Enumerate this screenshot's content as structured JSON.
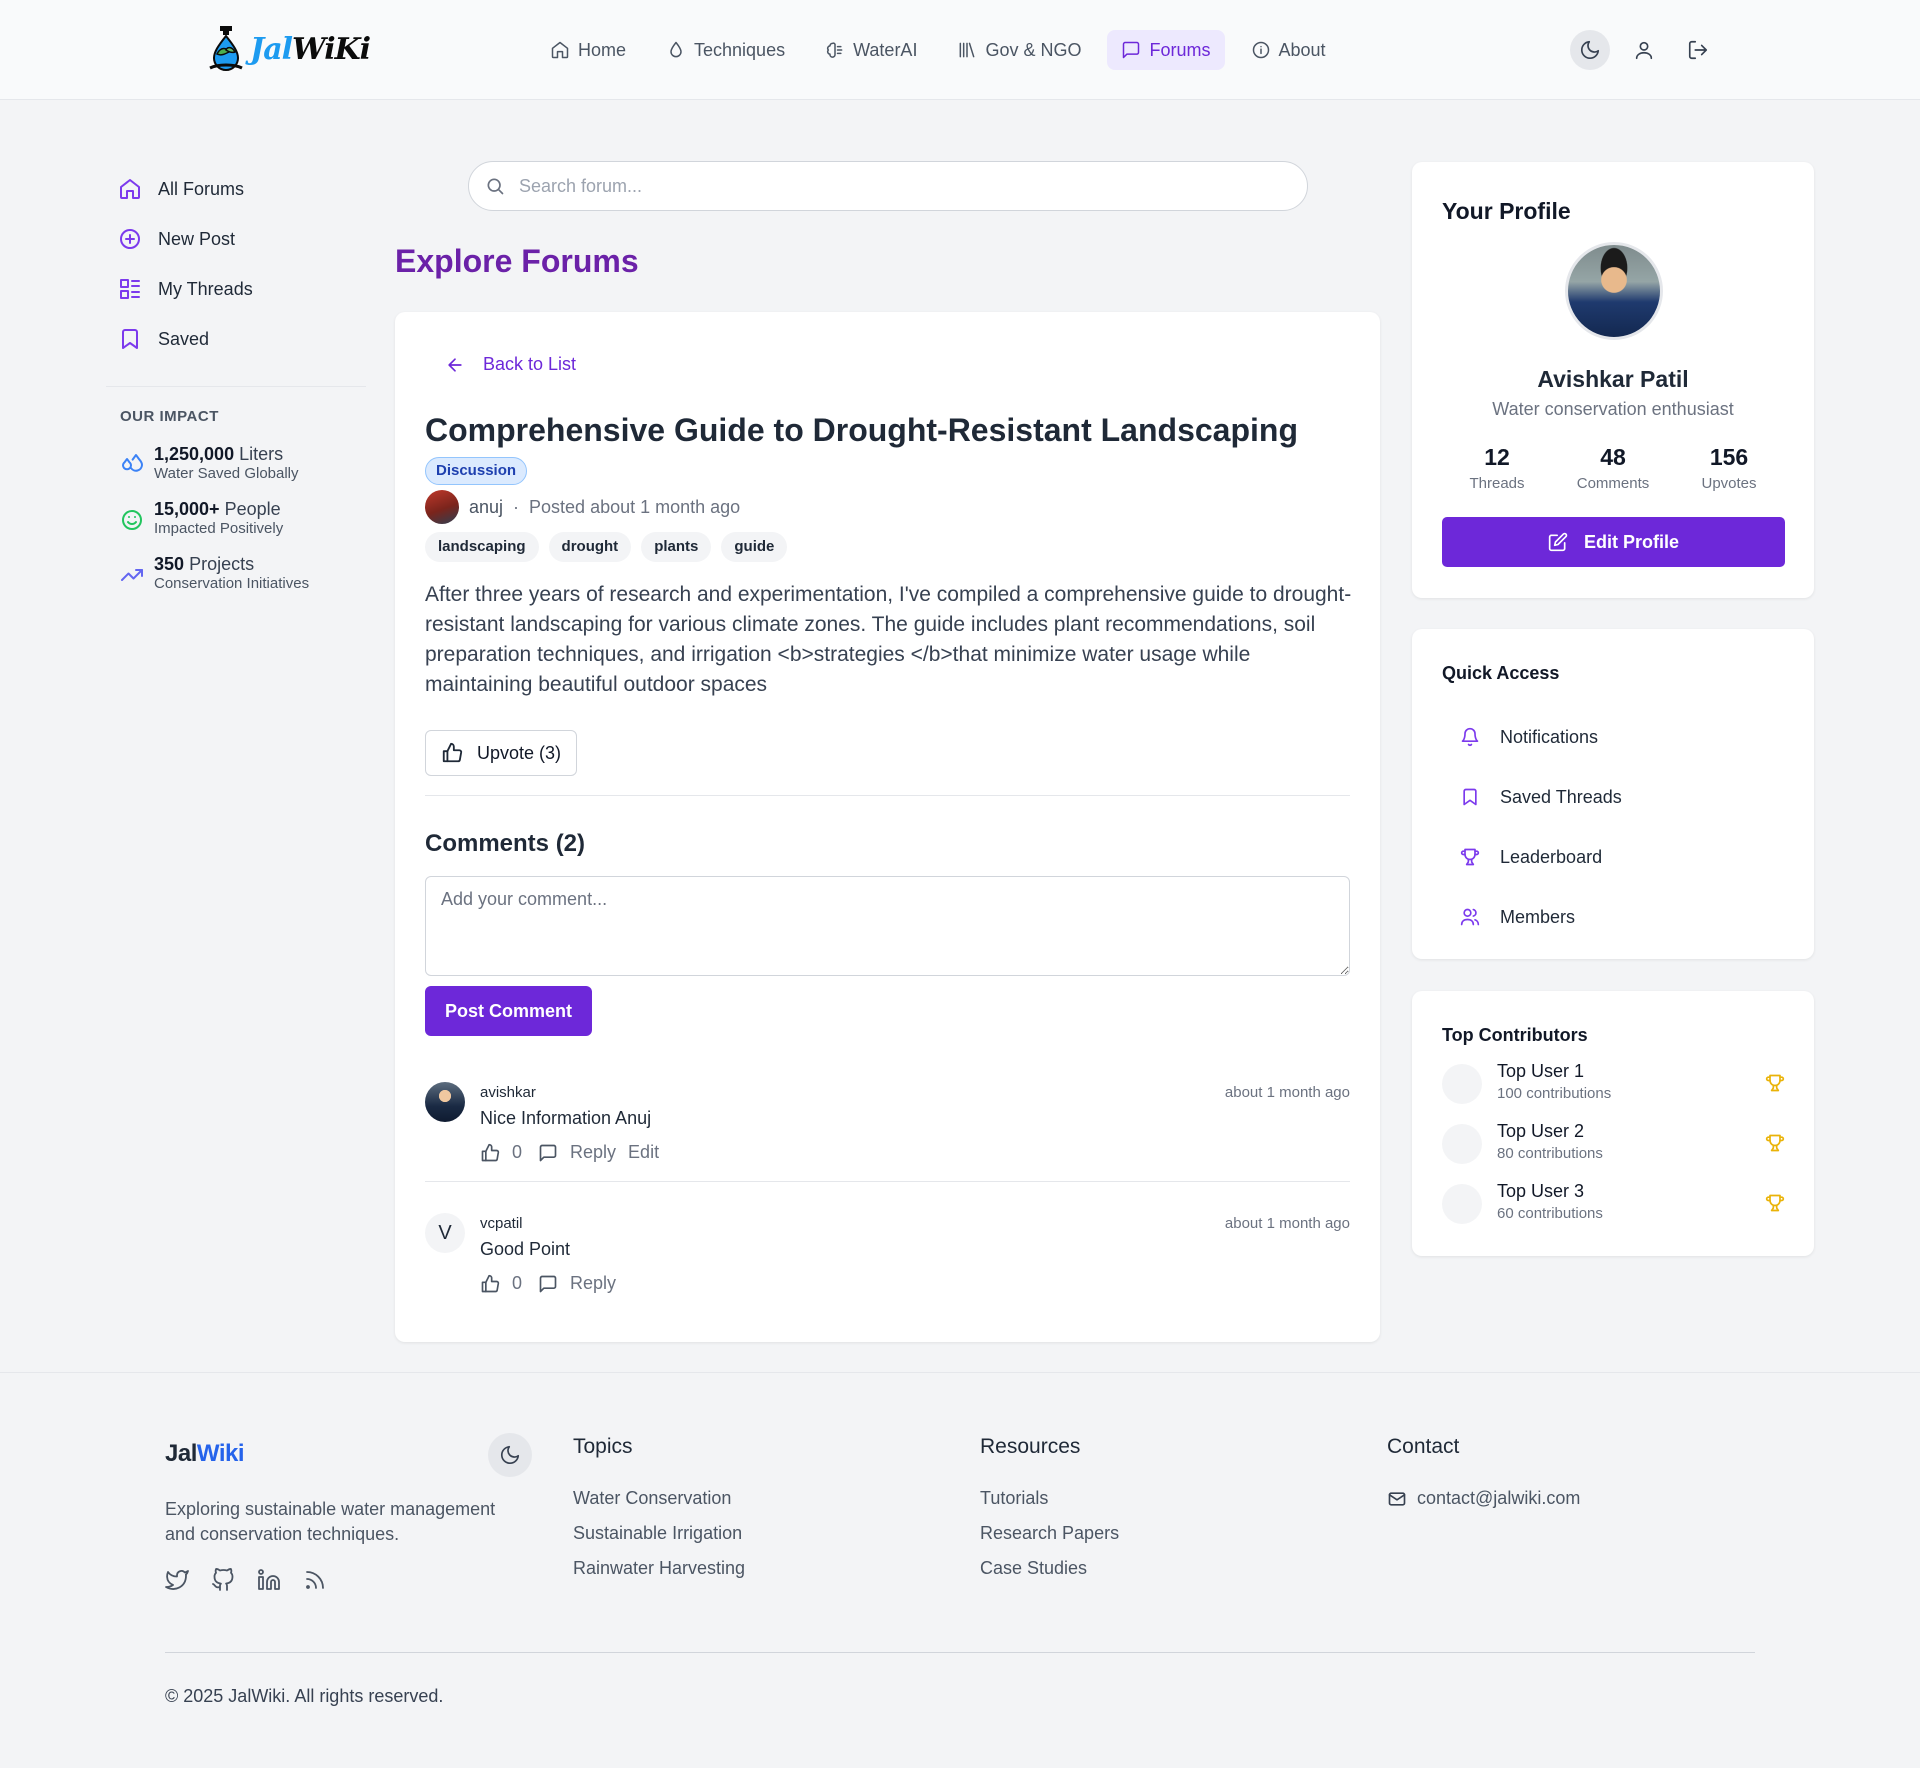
{
  "brand": {
    "logo_jal": "Jal",
    "logo_wiki": "WiKi",
    "footer_a": "Jal",
    "footer_b": "Wiki",
    "accent": "#6d28d9",
    "title_color": "#6b21a8"
  },
  "nav": {
    "items": [
      {
        "label": "Home",
        "icon": "home-icon"
      },
      {
        "label": "Techniques",
        "icon": "droplet-icon"
      },
      {
        "label": "WaterAI",
        "icon": "brain-icon"
      },
      {
        "label": "Gov & NGO",
        "icon": "library-icon"
      },
      {
        "label": "Forums",
        "icon": "message-square-icon",
        "active": true
      },
      {
        "label": "About",
        "icon": "info-icon"
      }
    ],
    "actions": [
      "moon-icon",
      "user-icon",
      "logout-icon"
    ]
  },
  "sidebar": {
    "items": [
      {
        "label": "All Forums",
        "icon": "home-icon"
      },
      {
        "label": "New Post",
        "icon": "plus-circle-icon"
      },
      {
        "label": "My Threads",
        "icon": "list-icon"
      },
      {
        "label": "Saved",
        "icon": "bookmark-icon"
      }
    ],
    "impact_title": "OUR IMPACT",
    "impact": [
      {
        "value": "1,250,000",
        "unit": "Liters",
        "sub": "Water Saved Globally",
        "icon": "droplets-icon",
        "color": "#3b82f6"
      },
      {
        "value": "15,000+",
        "unit": "People",
        "sub": "Impacted Positively",
        "icon": "smile-icon",
        "color": "#22c55e"
      },
      {
        "value": "350",
        "unit": "Projects",
        "sub": "Conservation Initiatives",
        "icon": "trending-up-icon",
        "color": "#6366f1"
      }
    ]
  },
  "search": {
    "placeholder": "Search forum...",
    "value": ""
  },
  "page_title": "Explore Forums",
  "post": {
    "back_label": "Back to List",
    "title": "Comprehensive Guide to Drought-Resistant Landscaping",
    "badge": "Discussion",
    "author": "anuj",
    "separator": "·",
    "posted": "Posted about 1 month ago",
    "tags": [
      "landscaping",
      "drought",
      "plants",
      "guide"
    ],
    "body": "After three years of research and experimentation, I've compiled a comprehensive guide to drought-resistant landscaping for various climate zones. The guide includes plant recommendations, soil preparation techniques, and irrigation <b>strategies </b>that minimize water usage while maintaining beautiful outdoor spaces",
    "upvote_label": "Upvote (3)"
  },
  "comments": {
    "title": "Comments (2)",
    "placeholder": "Add your comment...",
    "post_button": "Post Comment",
    "items": [
      {
        "user": "avishkar",
        "time": "about 1 month ago",
        "text": "Nice Information Anuj",
        "likes": "0",
        "reply": "Reply",
        "edit": "Edit",
        "avatar": "photo"
      },
      {
        "user": "vcpatil",
        "time": "about 1 month ago",
        "text": "Good Point",
        "likes": "0",
        "reply": "Reply",
        "avatar_letter": "V"
      }
    ]
  },
  "profile": {
    "title": "Your Profile",
    "name": "Avishkar Patil",
    "bio": "Water conservation enthusiast",
    "stats": [
      {
        "value": "12",
        "label": "Threads"
      },
      {
        "value": "48",
        "label": "Comments"
      },
      {
        "value": "156",
        "label": "Upvotes"
      }
    ],
    "edit_button": "Edit Profile"
  },
  "quick_access": {
    "title": "Quick Access",
    "items": [
      {
        "label": "Notifications",
        "icon": "bell-icon"
      },
      {
        "label": "Saved Threads",
        "icon": "bookmark-icon"
      },
      {
        "label": "Leaderboard",
        "icon": "trophy-icon"
      },
      {
        "label": "Members",
        "icon": "users-icon"
      }
    ]
  },
  "top_contributors": {
    "title": "Top Contributors",
    "items": [
      {
        "name": "Top User 1",
        "sub": "100 contributions"
      },
      {
        "name": "Top User 2",
        "sub": "80 contributions"
      },
      {
        "name": "Top User 3",
        "sub": "60 contributions"
      }
    ],
    "trophy_color": "#eab308"
  },
  "footer": {
    "description": "Exploring sustainable water management and conservation techniques.",
    "social": [
      "twitter-icon",
      "github-icon",
      "linkedin-icon",
      "rss-icon"
    ],
    "topics_title": "Topics",
    "topics": [
      "Water Conservation",
      "Sustainable Irrigation",
      "Rainwater Harvesting"
    ],
    "resources_title": "Resources",
    "resources": [
      "Tutorials",
      "Research Papers",
      "Case Studies"
    ],
    "contact_title": "Contact",
    "email": "contact@jalwiki.com",
    "copyright": "© 2025 JalWiki. All rights reserved."
  }
}
